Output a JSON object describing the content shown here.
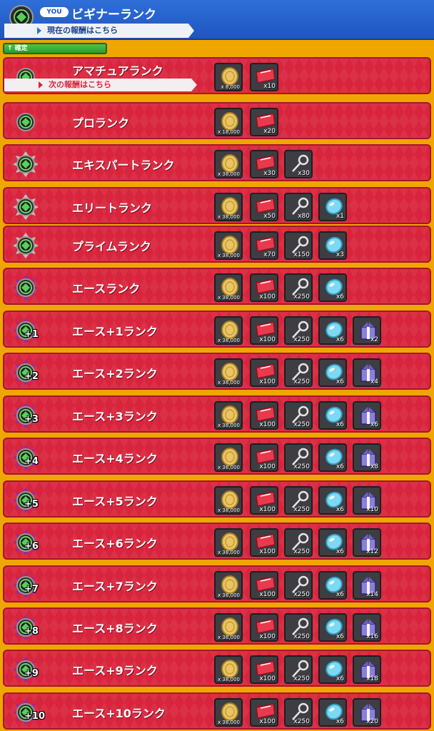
{
  "header": {
    "you_badge": "YOU",
    "title": "ビギナーランク",
    "ribbon": "現在の報酬はこちら"
  },
  "fixed_bar": "↑ 確定",
  "next_ribbon": "次の報酬はこちら",
  "colors": {
    "header_blue": "#1f55c0",
    "row_red": "#d8243c",
    "background_gold": "#f0a600",
    "confirm_green": "#3fae3a"
  },
  "reward_icon_names": {
    "coin": "gold-coin-icon",
    "ticket": "red-ticket-icon",
    "key": "silver-key-icon",
    "gem": "blue-gem-icon",
    "gift": "purple-gift-box-icon"
  },
  "ranks": [
    {
      "name": "アマチュアランク",
      "badge": "",
      "rewards": [
        "x 8,000",
        "x10"
      ]
    },
    {
      "name": "プロランク",
      "badge": "",
      "rewards": [
        "x 18,000",
        "x20"
      ]
    },
    {
      "name": "エキスパートランク",
      "badge": "",
      "rewards": [
        "x 38,000",
        "x30",
        "x30"
      ]
    },
    {
      "name": "エリートランク",
      "badge": "",
      "rewards": [
        "x 38,000",
        "x50",
        "x80",
        "x1"
      ]
    },
    {
      "name": "プライムランク",
      "badge": "",
      "rewards": [
        "x 38,000",
        "x70",
        "x150",
        "x3"
      ]
    },
    {
      "name": "エースランク",
      "badge": "",
      "rewards": [
        "x 38,000",
        "x100",
        "x250",
        "x6"
      ]
    },
    {
      "name": "エース+1ランク",
      "badge": "+1",
      "rewards": [
        "x 38,000",
        "x100",
        "x250",
        "x6",
        "x2"
      ]
    },
    {
      "name": "エース+2ランク",
      "badge": "+2",
      "rewards": [
        "x 38,000",
        "x100",
        "x250",
        "x6",
        "x4"
      ]
    },
    {
      "name": "エース+3ランク",
      "badge": "+3",
      "rewards": [
        "x 38,000",
        "x100",
        "x250",
        "x6",
        "x6"
      ]
    },
    {
      "name": "エース+4ランク",
      "badge": "+4",
      "rewards": [
        "x 38,000",
        "x100",
        "x250",
        "x6",
        "x8"
      ]
    },
    {
      "name": "エース+5ランク",
      "badge": "+5",
      "rewards": [
        "x 38,000",
        "x100",
        "x250",
        "x6",
        "x10"
      ]
    },
    {
      "name": "エース+6ランク",
      "badge": "+6",
      "rewards": [
        "x 38,000",
        "x100",
        "x250",
        "x6",
        "x12"
      ]
    },
    {
      "name": "エース+7ランク",
      "badge": "+7",
      "rewards": [
        "x 38,000",
        "x100",
        "x250",
        "x6",
        "x14"
      ]
    },
    {
      "name": "エース+8ランク",
      "badge": "+8",
      "rewards": [
        "x 38,000",
        "x100",
        "x250",
        "x6",
        "x16"
      ]
    },
    {
      "name": "エース+9ランク",
      "badge": "+9",
      "rewards": [
        "x 38,000",
        "x100",
        "x250",
        "x6",
        "x18"
      ]
    },
    {
      "name": "エース+10ランク",
      "badge": "+10",
      "rewards": [
        "x 38,000",
        "x100",
        "x250",
        "x6",
        "x20"
      ]
    }
  ]
}
